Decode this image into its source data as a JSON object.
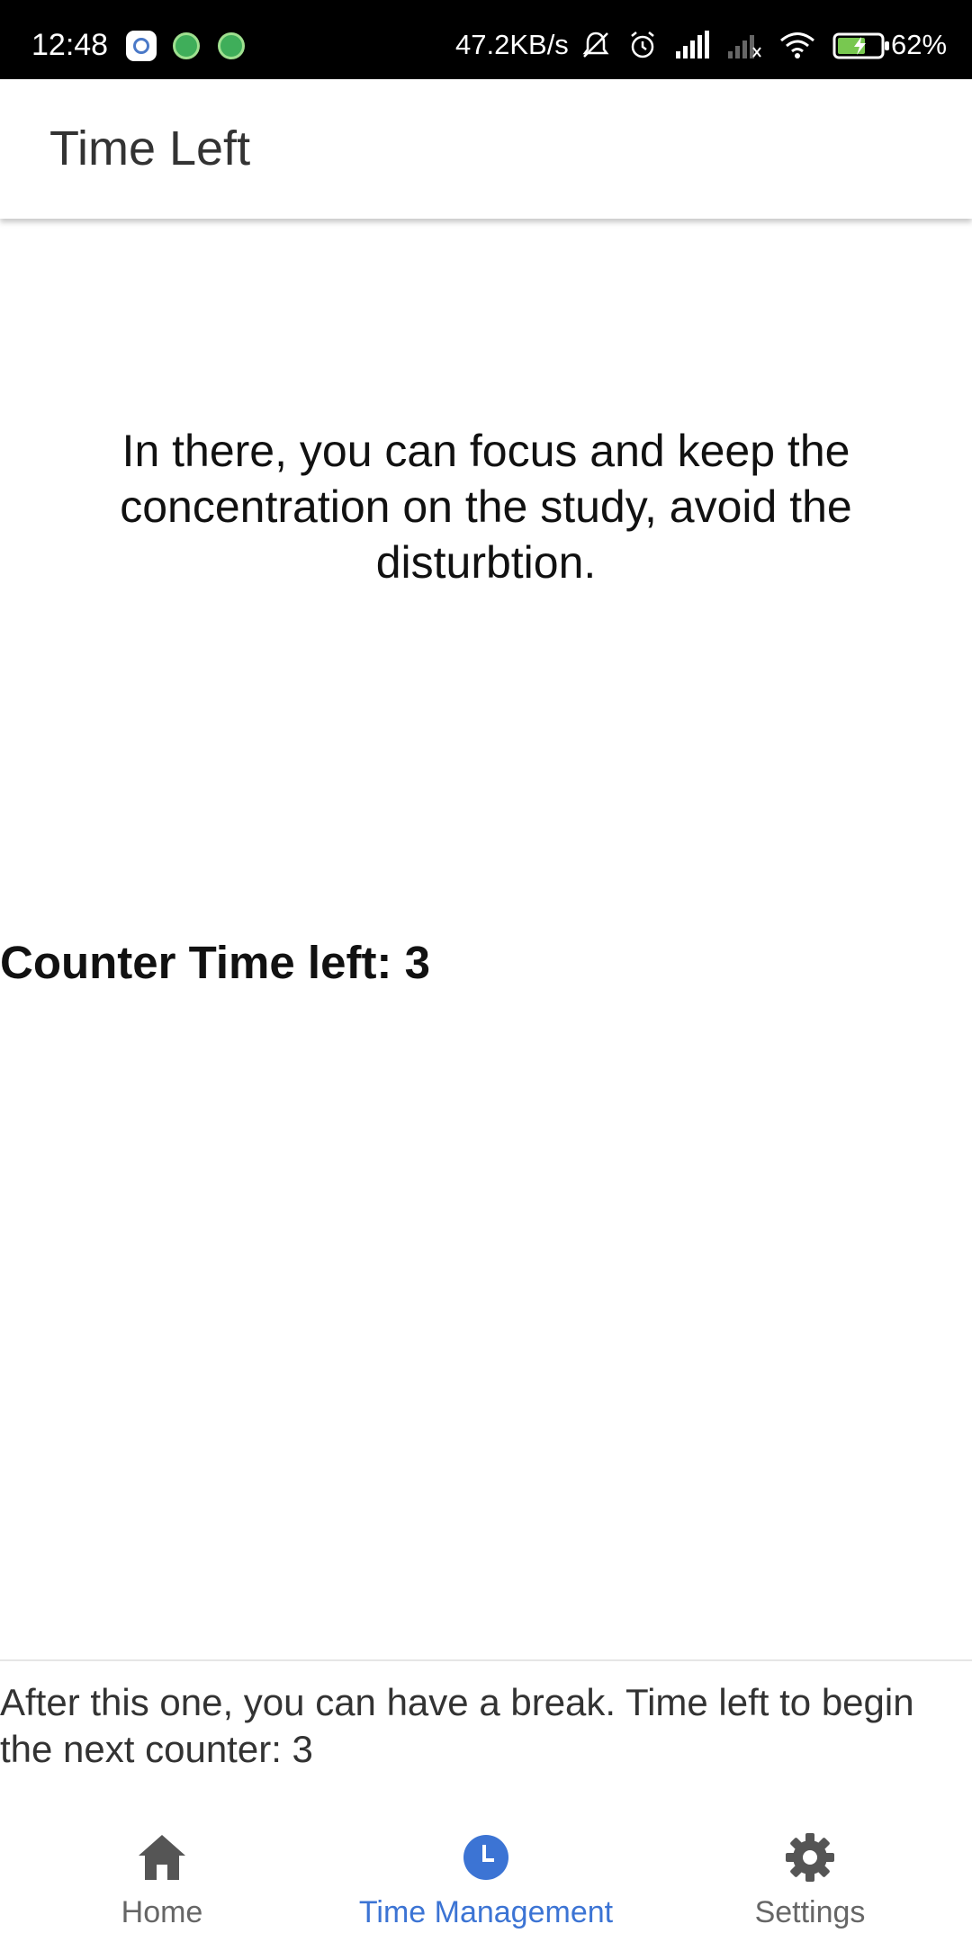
{
  "status_bar": {
    "time": "12:48",
    "net_speed": "47.2KB/s",
    "battery": "62%",
    "icons": [
      "settings-notification-icon",
      "robot-notification-icon",
      "robot-notification-icon",
      "mute-icon",
      "alarm-icon",
      "signal-icon",
      "no-signal-icon",
      "wifi-icon",
      "battery-charging-icon"
    ]
  },
  "app_bar": {
    "title": "Time Left"
  },
  "main": {
    "intro_text": "In there, you can focus and keep the concentration on the study, avoid the disturbtion.",
    "counter_text": "Counter Time left: 3"
  },
  "break_panel": {
    "text": "After this one, you can have a break. Time left to begin the next counter: 3"
  },
  "bottom_nav": {
    "items": [
      {
        "label": "Home",
        "icon": "home-icon",
        "active": false
      },
      {
        "label": "Time Management",
        "icon": "clock-icon",
        "active": true
      },
      {
        "label": "Settings",
        "icon": "gear-icon",
        "active": false
      }
    ]
  },
  "colors": {
    "accent": "#3c74d4",
    "inactive": "#666666",
    "status_bar_bg": "#000000"
  }
}
